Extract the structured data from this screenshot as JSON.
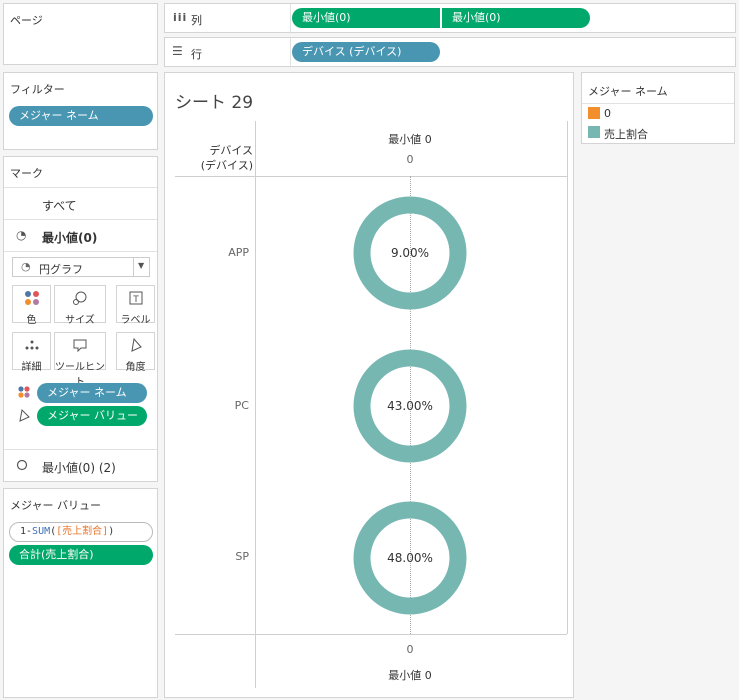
{
  "pages_card": {
    "title": "ページ"
  },
  "columns_shelf": {
    "icon": "columns-icon",
    "label": "列",
    "pills": [
      "最小値(0)",
      "最小値(0)"
    ]
  },
  "rows_shelf": {
    "icon": "rows-icon",
    "label": "行",
    "pills": [
      "デバイス (デバイス)"
    ]
  },
  "filters_card": {
    "title": "フィルター",
    "pills": [
      "メジャー ネーム"
    ]
  },
  "marks_card": {
    "title": "マーク",
    "all_label": "すべて",
    "section1_label": "最小値(0)",
    "mark_type": "円グラフ",
    "buttons": [
      {
        "label": "色",
        "icon": "color-icon"
      },
      {
        "label": "サイズ",
        "icon": "size-icon"
      },
      {
        "label": "ラベル",
        "icon": "label-icon"
      },
      {
        "label": "詳細",
        "icon": "detail-icon"
      },
      {
        "label": "ツールヒント",
        "icon": "tooltip-icon"
      },
      {
        "label": "角度",
        "icon": "angle-icon"
      }
    ],
    "pills": [
      "メジャー ネーム",
      "メジャー バリュー"
    ],
    "section2_label": "最小値(0) (2)"
  },
  "measure_values_card": {
    "title": "メジャー バリュー",
    "formula": {
      "prefix": "1-",
      "fn": "SUM",
      "open": "(",
      "field": "[売上割合]",
      "close": ")"
    },
    "sum_pill": "合計(売上割合)"
  },
  "sheet": {
    "title": "シート 29",
    "row_header": "デバイス\n(デバイス)",
    "top_axis_title": "最小値 0",
    "top_axis_tick": "0",
    "bottom_axis_tick": "0",
    "bottom_axis_title": "最小値 0"
  },
  "legend": {
    "title": "メジャー ネーム",
    "items": [
      {
        "label": "0",
        "color": "#f28e2b"
      },
      {
        "label": "売上割合",
        "color": "#76b7b2"
      }
    ]
  },
  "chart_data": {
    "type": "pie",
    "categories": [
      "APP",
      "PC",
      "SP"
    ],
    "series": [
      {
        "name": "0",
        "values": [
          0,
          0,
          0
        ]
      },
      {
        "name": "売上割合",
        "values": [
          9.0,
          43.0,
          48.0
        ]
      }
    ],
    "labels": [
      "9.00%",
      "43.00%",
      "48.00%"
    ],
    "colors": {
      "0": "#f28e2b",
      "売上割合": "#76b7b2"
    }
  }
}
